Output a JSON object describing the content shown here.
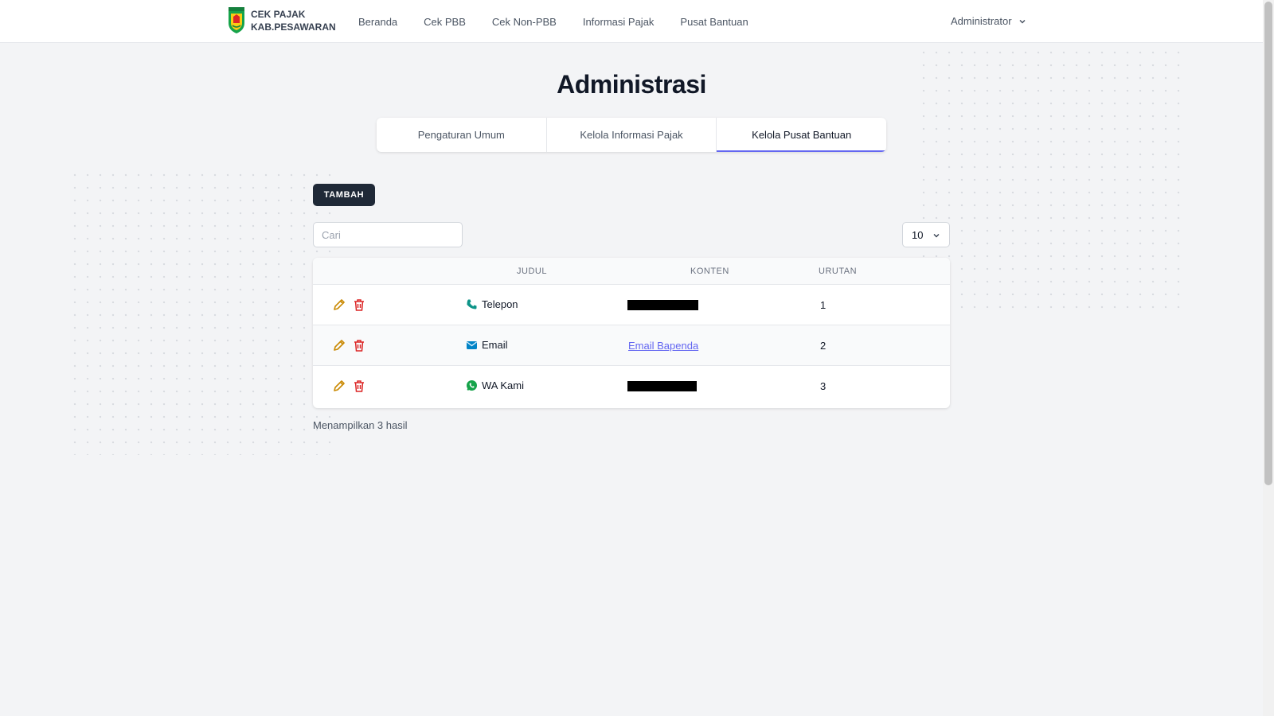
{
  "brand": {
    "line1": "CEK PAJAK",
    "line2": "KAB.PESAWARAN",
    "logo_icon": "shield-crest-icon"
  },
  "nav": {
    "links": [
      "Beranda",
      "Cek PBB",
      "Cek Non-PBB",
      "Informasi Pajak",
      "Pusat Bantuan"
    ],
    "user": "Administrator"
  },
  "page": {
    "title": "Administrasi"
  },
  "tabs": [
    {
      "label": "Pengaturan Umum",
      "active": false
    },
    {
      "label": "Kelola Informasi Pajak",
      "active": false
    },
    {
      "label": "Kelola Pusat Bantuan",
      "active": true
    }
  ],
  "toolbar": {
    "add_label": "TAMBAH",
    "search_placeholder": "Cari",
    "per_page": "10"
  },
  "table": {
    "headers": [
      "JUDUL",
      "KONTEN",
      "URUTAN"
    ],
    "rows": [
      {
        "title": "Telepon",
        "icon": "phone-icon",
        "content": "[redacted]",
        "order": "1"
      },
      {
        "title": "Email",
        "icon": "email-icon",
        "content": "Email Bapenda",
        "order": "2"
      },
      {
        "title": "WA Kami",
        "icon": "whatsapp-icon",
        "content": "[redacted]",
        "order": "3"
      }
    ]
  },
  "footer": {
    "results": "Menampilkan 3 hasil"
  },
  "colors": {
    "accent": "#6366f1",
    "dark_button": "#1f2937",
    "edit_icon": "#ca8a04",
    "delete_icon": "#dc2626"
  }
}
